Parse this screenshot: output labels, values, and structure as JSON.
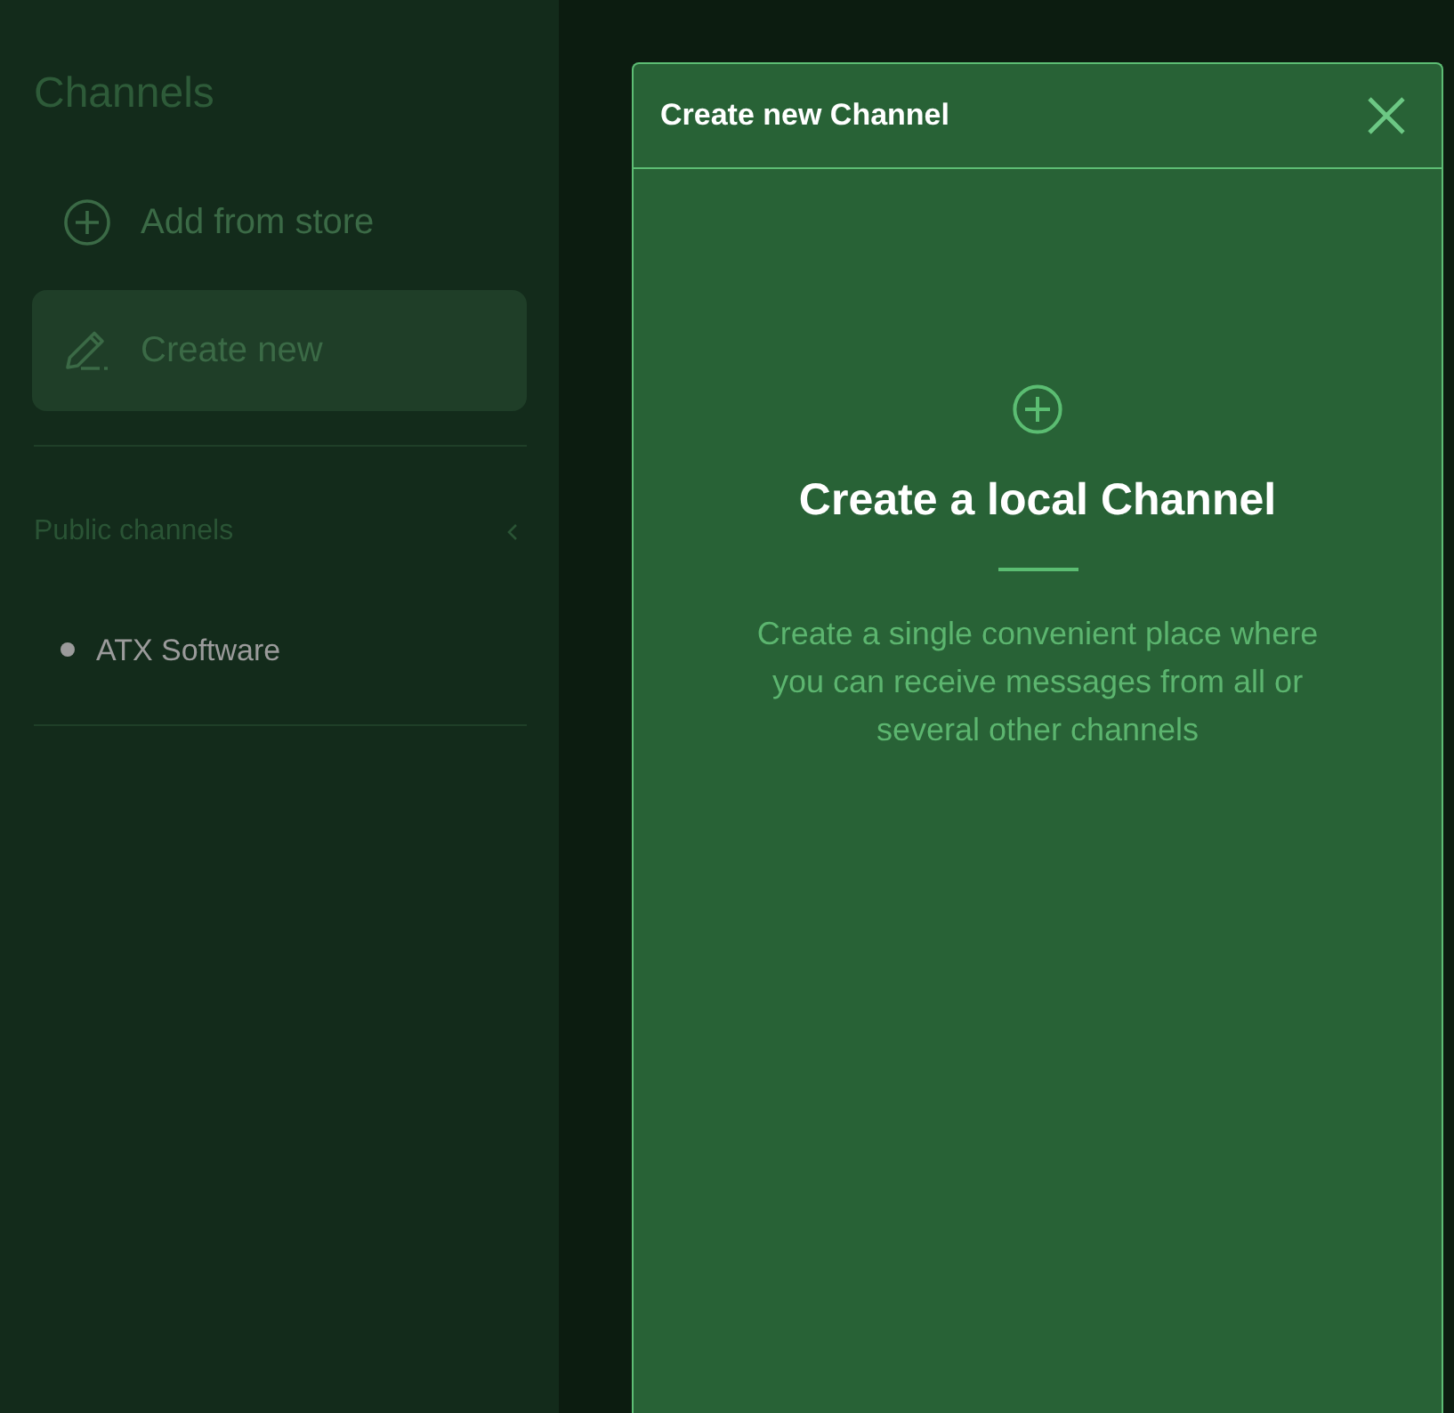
{
  "sidebar": {
    "title": "Channels",
    "items": [
      {
        "label": "Add from store",
        "kind": "add",
        "selected": false
      },
      {
        "label": "Create new",
        "kind": "create",
        "selected": true
      }
    ],
    "group": {
      "label": "Public channels",
      "expanded": true,
      "channels": [
        {
          "name": "ATX Software"
        }
      ]
    }
  },
  "dialog": {
    "title": "Create new Channel",
    "heading": "Create a local Channel",
    "description": "Create a single convenient place where you can receive messages from all or several other channels"
  }
}
